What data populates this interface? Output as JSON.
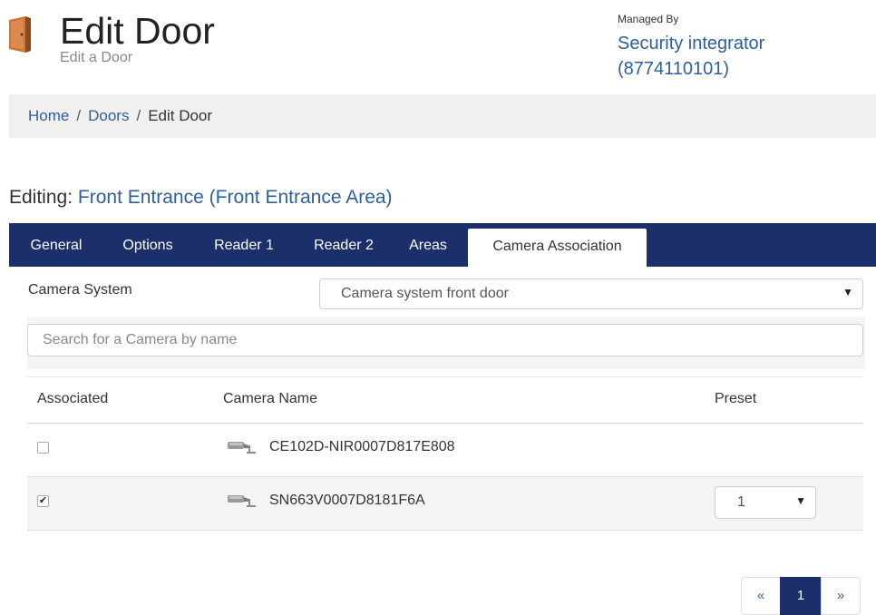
{
  "header": {
    "title": "Edit Door",
    "subtitle": "Edit a Door",
    "managed_by_label": "Managed By",
    "managed_by_name": "Security integrator",
    "managed_by_phone": "(8774110101)",
    "icon": "door-icon"
  },
  "breadcrumb": {
    "items": [
      "Home",
      "Doors",
      "Edit Door"
    ],
    "separator": "/"
  },
  "editing": {
    "label": "Editing:",
    "entity": "Front Entrance (Front Entrance Area)"
  },
  "tabs": [
    {
      "label": "General",
      "active": false
    },
    {
      "label": "Options",
      "active": false
    },
    {
      "label": "Reader 1",
      "active": false
    },
    {
      "label": "Reader 2",
      "active": false
    },
    {
      "label": "Areas",
      "active": false
    },
    {
      "label": "Camera Association",
      "active": true
    }
  ],
  "camera_system": {
    "label": "Camera System",
    "selected": "Camera system front door"
  },
  "search": {
    "placeholder": "Search for a Camera by name",
    "value": ""
  },
  "table": {
    "columns": [
      "Associated",
      "Camera Name",
      "Preset"
    ],
    "rows": [
      {
        "associated": false,
        "name": "CE102D-NIR0007D817E808",
        "preset": null,
        "icon": "camera-icon"
      },
      {
        "associated": true,
        "name": "SN663V0007D8181F6A",
        "preset": "1",
        "icon": "camera-icon"
      }
    ]
  },
  "pagination": {
    "prev": "«",
    "pages": [
      "1"
    ],
    "current": "1",
    "next": "»"
  },
  "colors": {
    "navy": "#1b2f6b",
    "link": "#2d5f9a",
    "door_icon": "#b86a2e"
  }
}
